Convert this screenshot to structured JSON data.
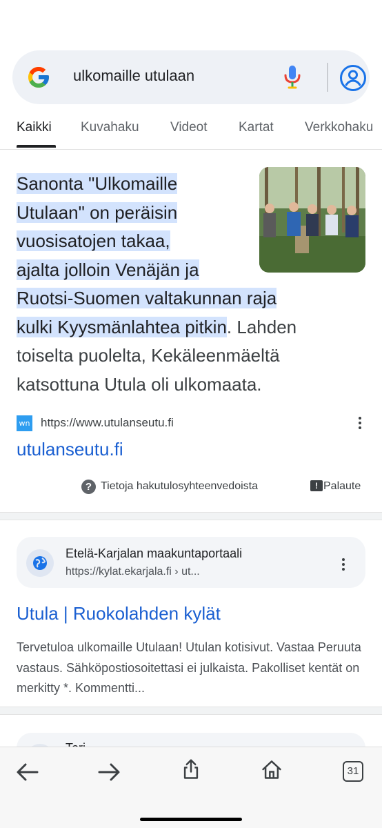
{
  "search": {
    "query": "ulkomaille utulaan"
  },
  "tabs": [
    {
      "label": "Kaikki",
      "active": true
    },
    {
      "label": "Kuvahaku"
    },
    {
      "label": "Videot"
    },
    {
      "label": "Kartat"
    },
    {
      "label": "Verkkohaku"
    }
  ],
  "snippet": {
    "highlight_lines": [
      "Sanonta \"Ulkomaille",
      "Utulaan\" on peräisin",
      "vuosisatojen takaa,",
      "ajalta jolloin Venäjän ja",
      "Ruotsi-Suomen valtakunnan raja",
      "kulki Kyysmänlahtea pitkin"
    ],
    "rest_inline": ". Lahden",
    "rest_lines": [
      "toiselta puolelta, Kekäleenmäeltä",
      "katsottuna Utula oli ulkomaata."
    ],
    "favicon_text": "wn",
    "source_url": "https://www.utulanseutu.fi",
    "source_title": "utulanseutu.fi",
    "about_label": "Tietoja hakutulosyhteenvedoista",
    "feedback_label": "Palaute"
  },
  "result2": {
    "site_name": "Etelä-Karjalan maakuntaportaali",
    "url": "https://kylat.ekarjala.fi › ut...",
    "title": "Utula | Ruokolahden kylät",
    "description": "Tervetuloa ulkomaille Utulaan! Utulan kotisivut. Vastaa Peruuta vastaus. Sähköpostiosoitettasi ei julkaista. Pakolliset kentät on merkitty *. Kommentti..."
  },
  "result3": {
    "site_name": "Tori"
  },
  "bottom": {
    "tab_count": "31"
  }
}
